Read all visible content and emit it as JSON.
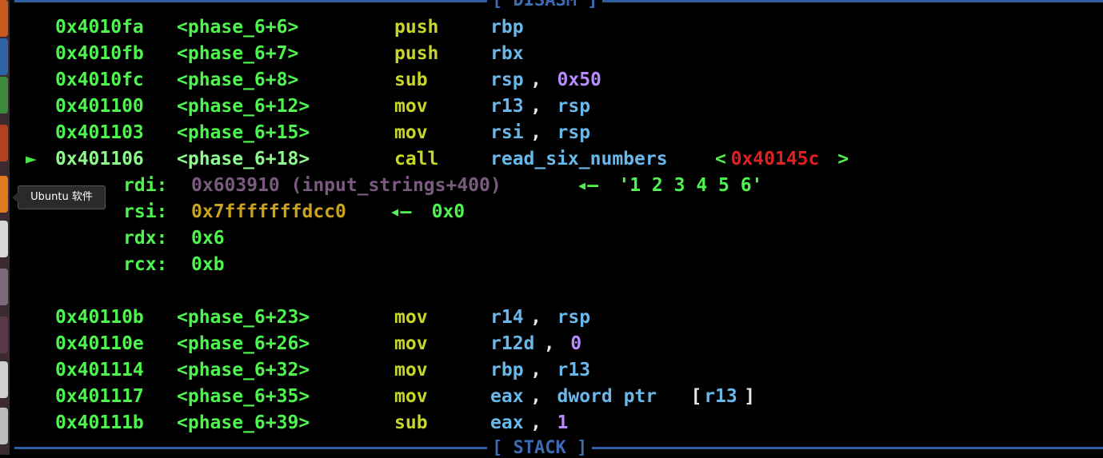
{
  "sections": {
    "top": "[ DISASM ]",
    "bottom": "[ STACK ]"
  },
  "tooltip": "Ubuntu 软件",
  "colors": {
    "address": "#4ef54e",
    "mnemonic": "#c8d629",
    "operand": "#6ab8ea",
    "immediate": "#b78cff",
    "target_addr": "#e02020",
    "string_ref": "#7b5a80",
    "stack_ref": "#c9a21e",
    "border": "#2f5fa5"
  },
  "disasm": [
    {
      "addr": "0x4010fa",
      "sym": "<phase_6+6>",
      "mn": "push",
      "ops": [
        {
          "t": "rbp",
          "k": "reg"
        }
      ]
    },
    {
      "addr": "0x4010fb",
      "sym": "<phase_6+7>",
      "mn": "push",
      "ops": [
        {
          "t": "rbx",
          "k": "reg"
        }
      ]
    },
    {
      "addr": "0x4010fc",
      "sym": "<phase_6+8>",
      "mn": "sub",
      "ops": [
        {
          "t": "rsp",
          "k": "reg"
        },
        {
          "t": ", ",
          "k": "punc"
        },
        {
          "t": "0x50",
          "k": "imm"
        }
      ]
    },
    {
      "addr": "0x401100",
      "sym": "<phase_6+12>",
      "mn": "mov",
      "ops": [
        {
          "t": "r13",
          "k": "reg"
        },
        {
          "t": ", ",
          "k": "punc"
        },
        {
          "t": "rsp",
          "k": "reg"
        }
      ]
    },
    {
      "addr": "0x401103",
      "sym": "<phase_6+15>",
      "mn": "mov",
      "ops": [
        {
          "t": "rsi",
          "k": "reg"
        },
        {
          "t": ", ",
          "k": "punc"
        },
        {
          "t": "rsp",
          "k": "reg"
        }
      ]
    },
    {
      "addr": "0x401106",
      "sym": "<phase_6+18>",
      "mn": "call",
      "current": true,
      "arrow": "►",
      "ops": [
        {
          "t": "read_six_numbers",
          "k": "func"
        },
        {
          "t": " <",
          "k": "lt"
        },
        {
          "t": "0x40145c",
          "k": "target"
        },
        {
          "t": ">",
          "k": "lt"
        }
      ]
    },
    {
      "args": [
        {
          "name": "rdi:",
          "val": [
            {
              "t": "0x603910 (input_strings+400)",
              "k": "strref"
            },
            {
              "t": " ◂— ",
              "k": "green"
            },
            {
              "t": "'1 2 3 4 5 6'",
              "k": "green"
            }
          ]
        },
        {
          "name": "rsi:",
          "val": [
            {
              "t": "0x7fffffffdcc0",
              "k": "stackref"
            },
            {
              "t": " ◂— ",
              "k": "green"
            },
            {
              "t": "0x0",
              "k": "green"
            }
          ]
        },
        {
          "name": "rdx:",
          "val": [
            {
              "t": "0x6",
              "k": "green"
            }
          ]
        },
        {
          "name": "rcx:",
          "val": [
            {
              "t": "0xb",
              "k": "green"
            }
          ]
        }
      ]
    },
    {
      "addr": "0x40110b",
      "sym": "<phase_6+23>",
      "mn": "mov",
      "ops": [
        {
          "t": "r14",
          "k": "reg"
        },
        {
          "t": ", ",
          "k": "punc"
        },
        {
          "t": "rsp",
          "k": "reg"
        }
      ]
    },
    {
      "addr": "0x40110e",
      "sym": "<phase_6+26>",
      "mn": "mov",
      "ops": [
        {
          "t": "r12d",
          "k": "reg"
        },
        {
          "t": ", ",
          "k": "punc"
        },
        {
          "t": "0",
          "k": "imm"
        }
      ]
    },
    {
      "addr": "0x401114",
      "sym": "<phase_6+32>",
      "mn": "mov",
      "ops": [
        {
          "t": "rbp",
          "k": "reg"
        },
        {
          "t": ", ",
          "k": "punc"
        },
        {
          "t": "r13",
          "k": "reg"
        }
      ]
    },
    {
      "addr": "0x401117",
      "sym": "<phase_6+35>",
      "mn": "mov",
      "ops": [
        {
          "t": "eax",
          "k": "reg"
        },
        {
          "t": ", ",
          "k": "punc"
        },
        {
          "t": "dword ptr ",
          "k": "reg"
        },
        {
          "t": "[",
          "k": "punc"
        },
        {
          "t": "r13",
          "k": "reg"
        },
        {
          "t": "]",
          "k": "punc"
        }
      ]
    },
    {
      "addr": "0x40111b",
      "sym": "<phase_6+39>",
      "mn": "sub",
      "ops": [
        {
          "t": "eax",
          "k": "reg"
        },
        {
          "t": ", ",
          "k": "punc"
        },
        {
          "t": "1",
          "k": "imm"
        }
      ]
    }
  ]
}
